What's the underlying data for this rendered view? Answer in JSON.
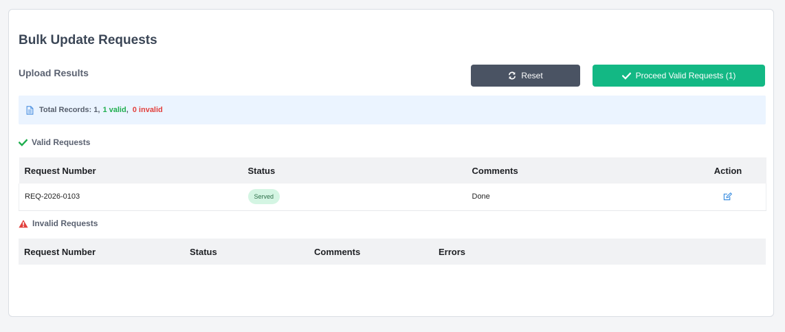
{
  "page": {
    "title": "Bulk Update Requests",
    "section_title": "Upload Results"
  },
  "buttons": {
    "reset_label": "Reset",
    "proceed_label": "Proceed Valid Requests (1)"
  },
  "summary": {
    "prefix": "Total Records: 1,",
    "valid_text": "1 valid",
    "separator": ",",
    "invalid_text": "0 invalid"
  },
  "valid_requests": {
    "heading": "Valid Requests",
    "columns": [
      "Request Number",
      "Status",
      "Comments",
      "Action"
    ],
    "rows": [
      {
        "request_number": "REQ-2026-0103",
        "status": "Served",
        "comments": "Done"
      }
    ]
  },
  "invalid_requests": {
    "heading": "Invalid Requests",
    "columns": [
      "Request Number",
      "Status",
      "Comments",
      "Errors"
    ],
    "rows": []
  },
  "colors": {
    "reset_button": "#4a5363",
    "proceed_button": "#13b884",
    "valid_green": "#1fae4e",
    "invalid_red": "#e2403d",
    "info_background": "#ebf4ff",
    "status_badge_bg": "#d4f5e3"
  },
  "icons": {
    "reset": "refresh-icon",
    "proceed": "check-icon",
    "summary": "document-icon",
    "valid_heading": "check-icon",
    "invalid_heading": "warning-triangle-icon",
    "row_action": "edit-icon"
  }
}
